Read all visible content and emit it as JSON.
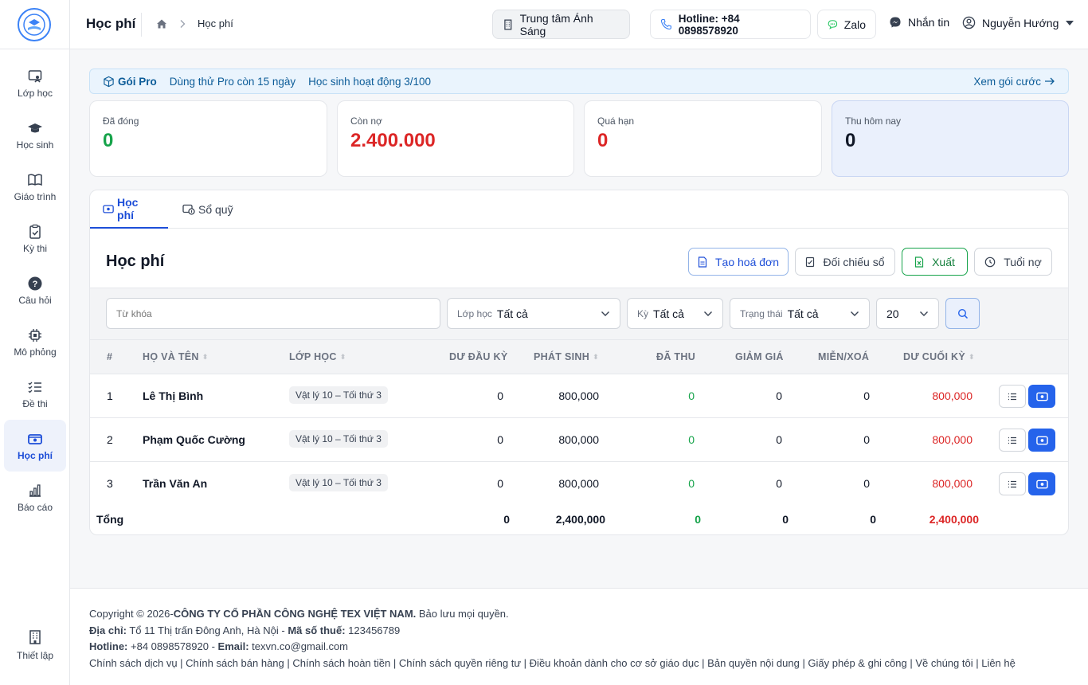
{
  "sidebar": {
    "items": [
      {
        "label": "Lớp học",
        "icon": "classroom-icon"
      },
      {
        "label": "Học sinh",
        "icon": "graduation-cap-icon"
      },
      {
        "label": "Giáo trình",
        "icon": "book-icon"
      },
      {
        "label": "Kỳ thi",
        "icon": "clipboard-check-icon"
      },
      {
        "label": "Câu hỏi",
        "icon": "question-icon"
      },
      {
        "label": "Mô phỏng",
        "icon": "chip-icon"
      },
      {
        "label": "Đề thi",
        "icon": "list-check-icon"
      },
      {
        "label": "Học phí",
        "icon": "money-icon",
        "active": true
      },
      {
        "label": "Báo cáo",
        "icon": "bar-chart-icon"
      }
    ],
    "settings_label": "Thiết lập"
  },
  "header": {
    "title": "Học phí",
    "breadcrumb": "Học phí",
    "center": "Trung tâm Ánh Sáng",
    "hotline": "Hotline: +84 0898578920",
    "zalo": "Zalo",
    "message": "Nhắn tin",
    "user": "Nguyễn Hướng"
  },
  "banner": {
    "plan": "Gói Pro",
    "trial": "Dùng thử Pro còn 15 ngày",
    "students": "Học sinh hoạt động 3/100",
    "link": "Xem gói cước"
  },
  "stats": [
    {
      "label": "Đã đóng",
      "value": "0",
      "color": "#16a34a"
    },
    {
      "label": "Còn nợ",
      "value": "2.400.000",
      "color": "#dc2626"
    },
    {
      "label": "Quá hạn",
      "value": "0",
      "color": "#dc2626"
    },
    {
      "label": "Thu hôm nay",
      "value": "0",
      "color": "#111827"
    }
  ],
  "tabs": [
    "Học phí",
    "Sổ quỹ"
  ],
  "section": {
    "title": "Học phí",
    "buttons": {
      "create": "Tạo hoá đơn",
      "reconcile": "Đối chiếu sổ",
      "export": "Xuất",
      "aging": "Tuổi nợ"
    }
  },
  "filters": {
    "keyword_placeholder": "Từ khóa",
    "class_label": "Lớp học",
    "class_value": "Tất cả",
    "term_label": "Kỳ",
    "term_value": "Tất cả",
    "status_label": "Trạng thái",
    "status_value": "Tất cả",
    "page_size": "20"
  },
  "table": {
    "columns": [
      "#",
      "HỌ VÀ TÊN",
      "LỚP HỌC",
      "DƯ ĐẦU KỲ",
      "PHÁT SINH",
      "ĐÃ THU",
      "GIẢM GIÁ",
      "MIỄN/XOÁ",
      "DƯ CUỐI KỲ"
    ],
    "rows": [
      {
        "idx": "1",
        "name": "Lê Thị Bình",
        "class": "Vật lý 10 – Tối thứ 3",
        "opening": "0",
        "incurred": "800,000",
        "paid": "0",
        "discount": "0",
        "waived": "0",
        "closing": "800,000"
      },
      {
        "idx": "2",
        "name": "Phạm Quốc Cường",
        "class": "Vật lý 10 – Tối thứ 3",
        "opening": "0",
        "incurred": "800,000",
        "paid": "0",
        "discount": "0",
        "waived": "0",
        "closing": "800,000"
      },
      {
        "idx": "3",
        "name": "Trần Văn An",
        "class": "Vật lý 10 – Tối thứ 3",
        "opening": "0",
        "incurred": "800,000",
        "paid": "0",
        "discount": "0",
        "waived": "0",
        "closing": "800,000"
      }
    ],
    "total": {
      "label": "Tổng",
      "opening": "0",
      "incurred": "2,400,000",
      "paid": "0",
      "discount": "0",
      "waived": "0",
      "closing": "2,400,000"
    }
  },
  "footer": {
    "copyright_prefix": "Copyright © 2026-",
    "company": "CÔNG TY CỔ PHẦN CÔNG NGHỆ TEX VIỆT NAM.",
    "rights": " Bảo lưu mọi quyền.",
    "address_label": "Địa chỉ:",
    "address": " Tổ 11 Thị trấn Đông Anh, Hà Nội - ",
    "tax_label": "Mã số thuế:",
    "tax": " 123456789",
    "hotline_label": "Hotline:",
    "hotline": " +84 0898578920 - ",
    "email_label": "Email:",
    "email": " texvn.co@gmail.com",
    "links": "Chính sách dịch vụ | Chính sách bán hàng | Chính sách hoàn tiền | Chính sách quyền riêng tư | Điều khoản dành cho cơ sở giáo dục | Bản quyền nội dung | Giấy phép & ghi công | Về chúng tôi | Liên hệ"
  }
}
